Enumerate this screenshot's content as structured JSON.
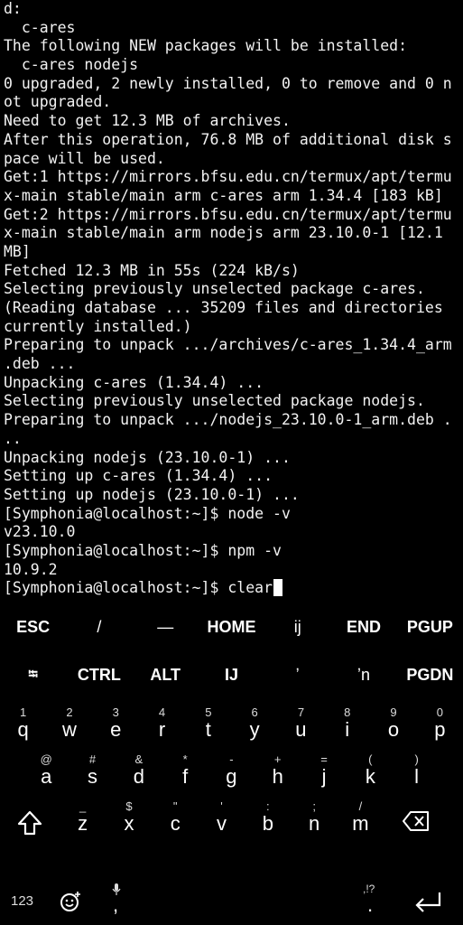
{
  "terminal": {
    "lines": [
      "d:",
      "  c-ares",
      "The following NEW packages will be installed:",
      "  c-ares nodejs",
      "0 upgraded, 2 newly installed, 0 to remove and 0 n",
      "ot upgraded.",
      "Need to get 12.3 MB of archives.",
      "After this operation, 76.8 MB of additional disk s",
      "pace will be used.",
      "Get:1 https://mirrors.bfsu.edu.cn/termux/apt/termu",
      "x-main stable/main arm c-ares arm 1.34.4 [183 kB]",
      "Get:2 https://mirrors.bfsu.edu.cn/termux/apt/termu",
      "x-main stable/main arm nodejs arm 23.10.0-1 [12.1",
      "MB]",
      "Fetched 12.3 MB in 55s (224 kB/s)",
      "Selecting previously unselected package c-ares.",
      "(Reading database ... 35209 files and directories",
      "currently installed.)",
      "Preparing to unpack .../archives/c-ares_1.34.4_arm",
      ".deb ...",
      "Unpacking c-ares (1.34.4) ...",
      "Selecting previously unselected package nodejs.",
      "Preparing to unpack .../nodejs_23.10.0-1_arm.deb .",
      "..",
      "Unpacking nodejs (23.10.0-1) ...",
      "Setting up c-ares (1.34.4) ...",
      "Setting up nodejs (23.10.0-1) ...",
      "[Symphonia@localhost:~]$ node -v",
      "v23.10.0",
      "[Symphonia@localhost:~]$ npm -v",
      "10.9.2"
    ],
    "prompt": "[Symphonia@localhost:~]$ ",
    "current_input": "clear"
  },
  "extra_keys": {
    "row1": [
      "ESC",
      "/",
      "—",
      "HOME",
      "ij",
      "END",
      "PGUP"
    ],
    "row2": [
      "⭾",
      "CTRL",
      "ALT",
      "IJ",
      "ʼ",
      "ʼn",
      "PGDN"
    ]
  },
  "keyboard": {
    "row1": [
      {
        "hint": "1",
        "key": "q"
      },
      {
        "hint": "2",
        "key": "w"
      },
      {
        "hint": "3",
        "key": "e"
      },
      {
        "hint": "4",
        "key": "r"
      },
      {
        "hint": "5",
        "key": "t"
      },
      {
        "hint": "6",
        "key": "y"
      },
      {
        "hint": "7",
        "key": "u"
      },
      {
        "hint": "8",
        "key": "i"
      },
      {
        "hint": "9",
        "key": "o"
      },
      {
        "hint": "0",
        "key": "p"
      }
    ],
    "row2": [
      {
        "hint": "@",
        "key": "a"
      },
      {
        "hint": "#",
        "key": "s"
      },
      {
        "hint": "&",
        "key": "d"
      },
      {
        "hint": "*",
        "key": "f"
      },
      {
        "hint": "-",
        "key": "g"
      },
      {
        "hint": "+",
        "key": "h"
      },
      {
        "hint": "=",
        "key": "j"
      },
      {
        "hint": "(",
        "key": "k"
      },
      {
        "hint": ")",
        "key": "l"
      }
    ],
    "row3": [
      {
        "hint": "_",
        "key": "z"
      },
      {
        "hint": "$",
        "key": "x"
      },
      {
        "hint": "\"",
        "key": "c"
      },
      {
        "hint": "'",
        "key": "v"
      },
      {
        "hint": ":",
        "key": "b"
      },
      {
        "hint": ";",
        "key": "n"
      },
      {
        "hint": "/",
        "key": "m"
      }
    ],
    "numbers_label": "123",
    "comma_key": ",",
    "period_key": ".",
    "period_hint": ",!?"
  }
}
